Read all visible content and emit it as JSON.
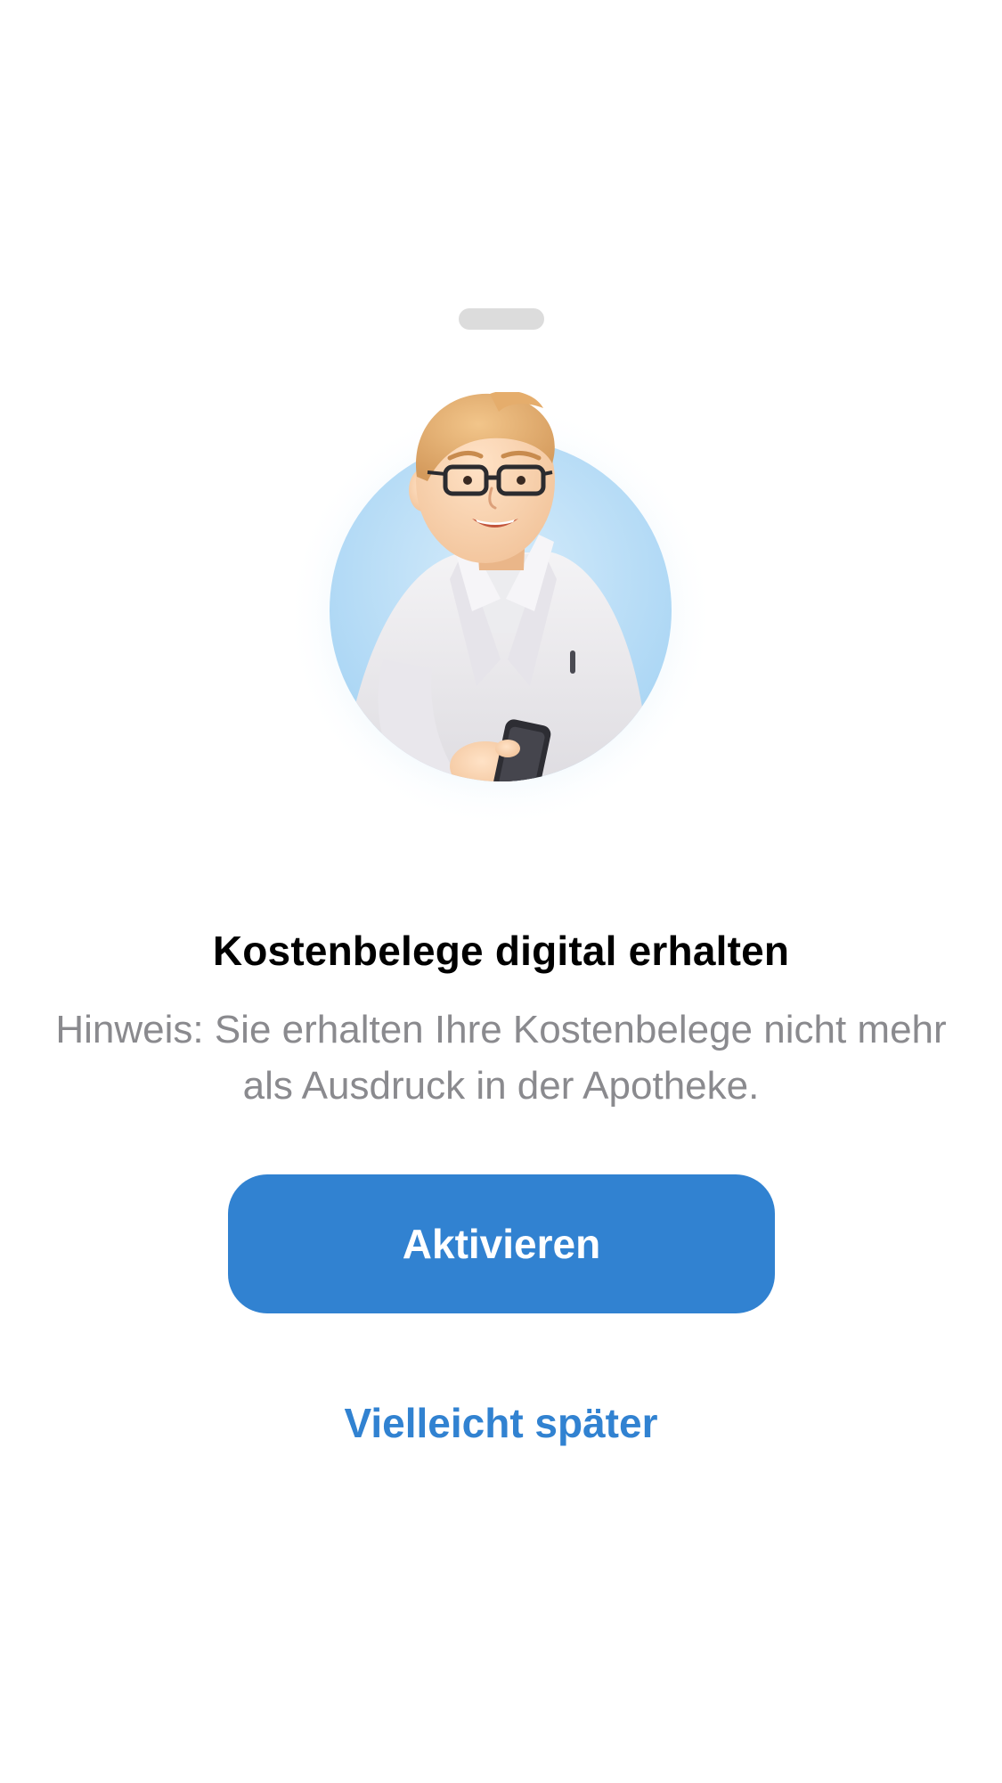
{
  "sheet": {
    "title": "Kostenbelege digital erhalten",
    "hint": "Hinweis: Sie erhalten Ihre Kostenbelege nicht mehr als Ausdruck in der Apotheke.",
    "primary_button_label": "Aktivieren",
    "secondary_button_label": "Vielleicht später"
  },
  "illustration": {
    "icon": "pharmacist-avatar-icon"
  },
  "colors": {
    "accent": "#3182d1",
    "title_text": "#000000",
    "hint_text": "#8a8a8e",
    "avatar_background": "#b9ddf6",
    "grabber": "#dcdcdc"
  }
}
